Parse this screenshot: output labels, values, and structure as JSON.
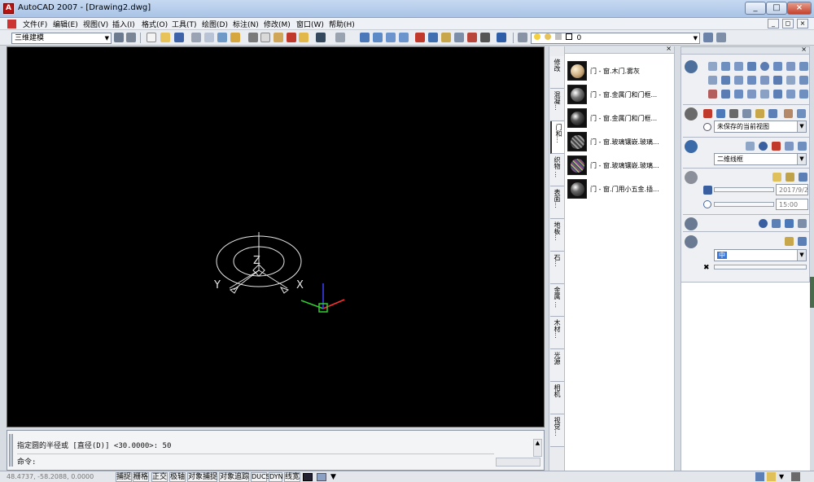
{
  "window": {
    "app_title": "AutoCAD 2007 - [Drawing2.dwg]",
    "minimize": "_",
    "maximize": "□",
    "close": "×"
  },
  "menu": {
    "items": [
      "文件(F)",
      "编辑(E)",
      "视图(V)",
      "插入(I)",
      "格式(O)",
      "工具(T)",
      "绘图(D)",
      "标注(N)",
      "修改(M)",
      "窗口(W)",
      "帮助(H)"
    ],
    "mdi_buttons": [
      "_",
      "◻",
      "×"
    ]
  },
  "toolbar": {
    "workspace": "三维建模",
    "layer_value": "0"
  },
  "viewport": {
    "ucs": {
      "z": "Z",
      "y": "Y",
      "x": "X"
    },
    "colors": {
      "background": "#000000",
      "wire": "#e6e6e6",
      "x_axis": "#ff3030",
      "y_axis": "#30d030",
      "z_axis": "#4040ff"
    }
  },
  "command": {
    "history": "指定圆的半径或 [直径(D)] <30.0000>: 50",
    "prompt": "命令:"
  },
  "status": {
    "coords": "48.4737, -58.2088, 0.0000",
    "toggles": [
      "捕捉",
      "栅格",
      "正交",
      "极轴",
      "对象捕捉",
      "对象追踪",
      "DUCS",
      "DYN",
      "线宽"
    ]
  },
  "palette_tabs": [
    {
      "label": "修改",
      "active": false
    },
    {
      "label": "混凝...",
      "active": false
    },
    {
      "label": "门和...",
      "active": true
    },
    {
      "label": "织物 ...",
      "active": false
    },
    {
      "label": "表面...",
      "active": false
    },
    {
      "label": "地板...",
      "active": false
    },
    {
      "label": "石...",
      "active": false
    },
    {
      "label": "金属 ...",
      "active": false
    },
    {
      "label": "木材...",
      "active": false
    },
    {
      "label": "光源",
      "active": false
    },
    {
      "label": "相机",
      "active": false
    },
    {
      "label": "视觉...",
      "active": false
    }
  ],
  "materials": [
    {
      "label": "门 - 窗.木门.雾灰",
      "color": "#c9a87a"
    },
    {
      "label": "门 - 窗.金属门和门框...",
      "color": "#2a2a2a"
    },
    {
      "label": "门 - 窗.金属门和门框...",
      "color": "#1a1a1a"
    },
    {
      "label": "门 - 窗.玻璃镶嵌.玻璃...",
      "color": "#3a3a3a"
    },
    {
      "label": "门 - 窗.玻璃镶嵌.玻璃...",
      "color": "#3a5a6a"
    },
    {
      "label": "门 - 窗.门用小五金.插...",
      "color": "#222222"
    }
  ],
  "dashboard": {
    "named_view": "未保存的当前视图",
    "visual_style": "二维线框",
    "date": "2017/9/2",
    "time": "15:00",
    "light_mode": "中"
  }
}
